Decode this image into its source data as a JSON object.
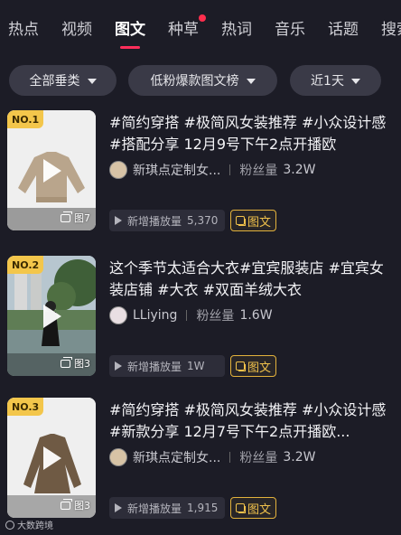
{
  "tabs": [
    {
      "label": "热点"
    },
    {
      "label": "视频"
    },
    {
      "label": "图文"
    },
    {
      "label": "种草"
    },
    {
      "label": "热词"
    },
    {
      "label": "音乐"
    },
    {
      "label": "话题"
    },
    {
      "label": "搜索"
    }
  ],
  "active_tab": "图文",
  "filters": {
    "category": "全部垂类",
    "list": "低粉爆款图文榜",
    "period": "近1天"
  },
  "cards": [
    {
      "rank": "NO.1",
      "title": "#简约穿搭 #极简风女装推荐 #小众设计感 #搭配分享 12月9号下午2点开播欧",
      "author": "新琪点定制女...",
      "fans_label": "粉丝量",
      "fans": "3.2W",
      "image_count": "图7",
      "plays_label": "新增播放量",
      "plays": "5,370",
      "type_tag": "图文",
      "thumb_color": "#b9a58c"
    },
    {
      "rank": "NO.2",
      "title": "这个季节太适合大衣#宜宾服装店 #宜宾女装店铺 #大衣 #双面羊绒大衣",
      "author": "LLiying",
      "fans_label": "粉丝量",
      "fans": "1.6W",
      "image_count": "图3",
      "plays_label": "新增播放量",
      "plays": "1W",
      "type_tag": "图文",
      "thumb_color": "#4f6a4a"
    },
    {
      "rank": "NO.3",
      "title": "#简约穿搭 #极简风女装推荐 #小众设计感 #新款分享 12月7号下午2点开播欧...",
      "author": "新琪点定制女...",
      "fans_label": "粉丝量",
      "fans": "3.2W",
      "image_count": "图3",
      "plays_label": "新增播放量",
      "plays": "1,915",
      "type_tag": "图文",
      "thumb_color": "#6f5a44"
    }
  ],
  "watermark": "大数跨境"
}
